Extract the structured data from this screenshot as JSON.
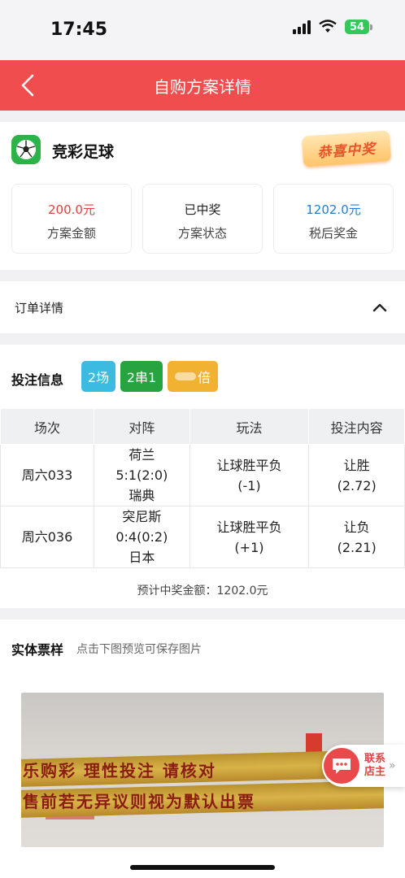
{
  "status_bar": {
    "time": "17:45",
    "battery": "54"
  },
  "header": {
    "title": "自购方案详情"
  },
  "lottery": {
    "name": "竞彩足球",
    "badge": "恭喜中奖",
    "stats": [
      {
        "value": "200.0元",
        "label": "方案金额",
        "color": "#e0433f"
      },
      {
        "value": "已中奖",
        "label": "方案状态",
        "color": "#222222"
      },
      {
        "value": "1202.0元",
        "label": "税后奖金",
        "color": "#1e7fd6"
      }
    ]
  },
  "order": {
    "label": "订单详情"
  },
  "bet": {
    "title": "投注信息",
    "tags": {
      "matches": "2场",
      "combo": "2串1",
      "multiplier": "倍"
    },
    "columns": [
      "场次",
      "对阵",
      "玩法",
      "投注内容"
    ],
    "rows": [
      {
        "match_no": "周六033",
        "home": "荷兰",
        "score": "5:1(2:0)",
        "away": "瑞典",
        "play": "让球胜平负",
        "handicap": "(-1)",
        "pick": "让胜",
        "odds": "(2.72)"
      },
      {
        "match_no": "周六036",
        "home": "突尼斯",
        "score": "0:4(0:2)",
        "away": "日本",
        "play": "让球胜平负",
        "handicap": "(+1)",
        "pick": "让负",
        "odds": "(2.21)"
      }
    ],
    "estimate": "预计中奖金额：1202.0元"
  },
  "ticket": {
    "title": "实体票样",
    "hint": "点击下图预览可保存图片",
    "photo_line1": "乐购彩  理性投注  请核对",
    "photo_line2": "售前若无异议则视为默认出票"
  },
  "contact": {
    "line1": "联系",
    "line2": "店主",
    "arrow": "»"
  },
  "colors": {
    "header": "#ef4d4e",
    "accent_red": "#e0433f",
    "blue": "#1e7fd6",
    "green": "#27a33f"
  }
}
